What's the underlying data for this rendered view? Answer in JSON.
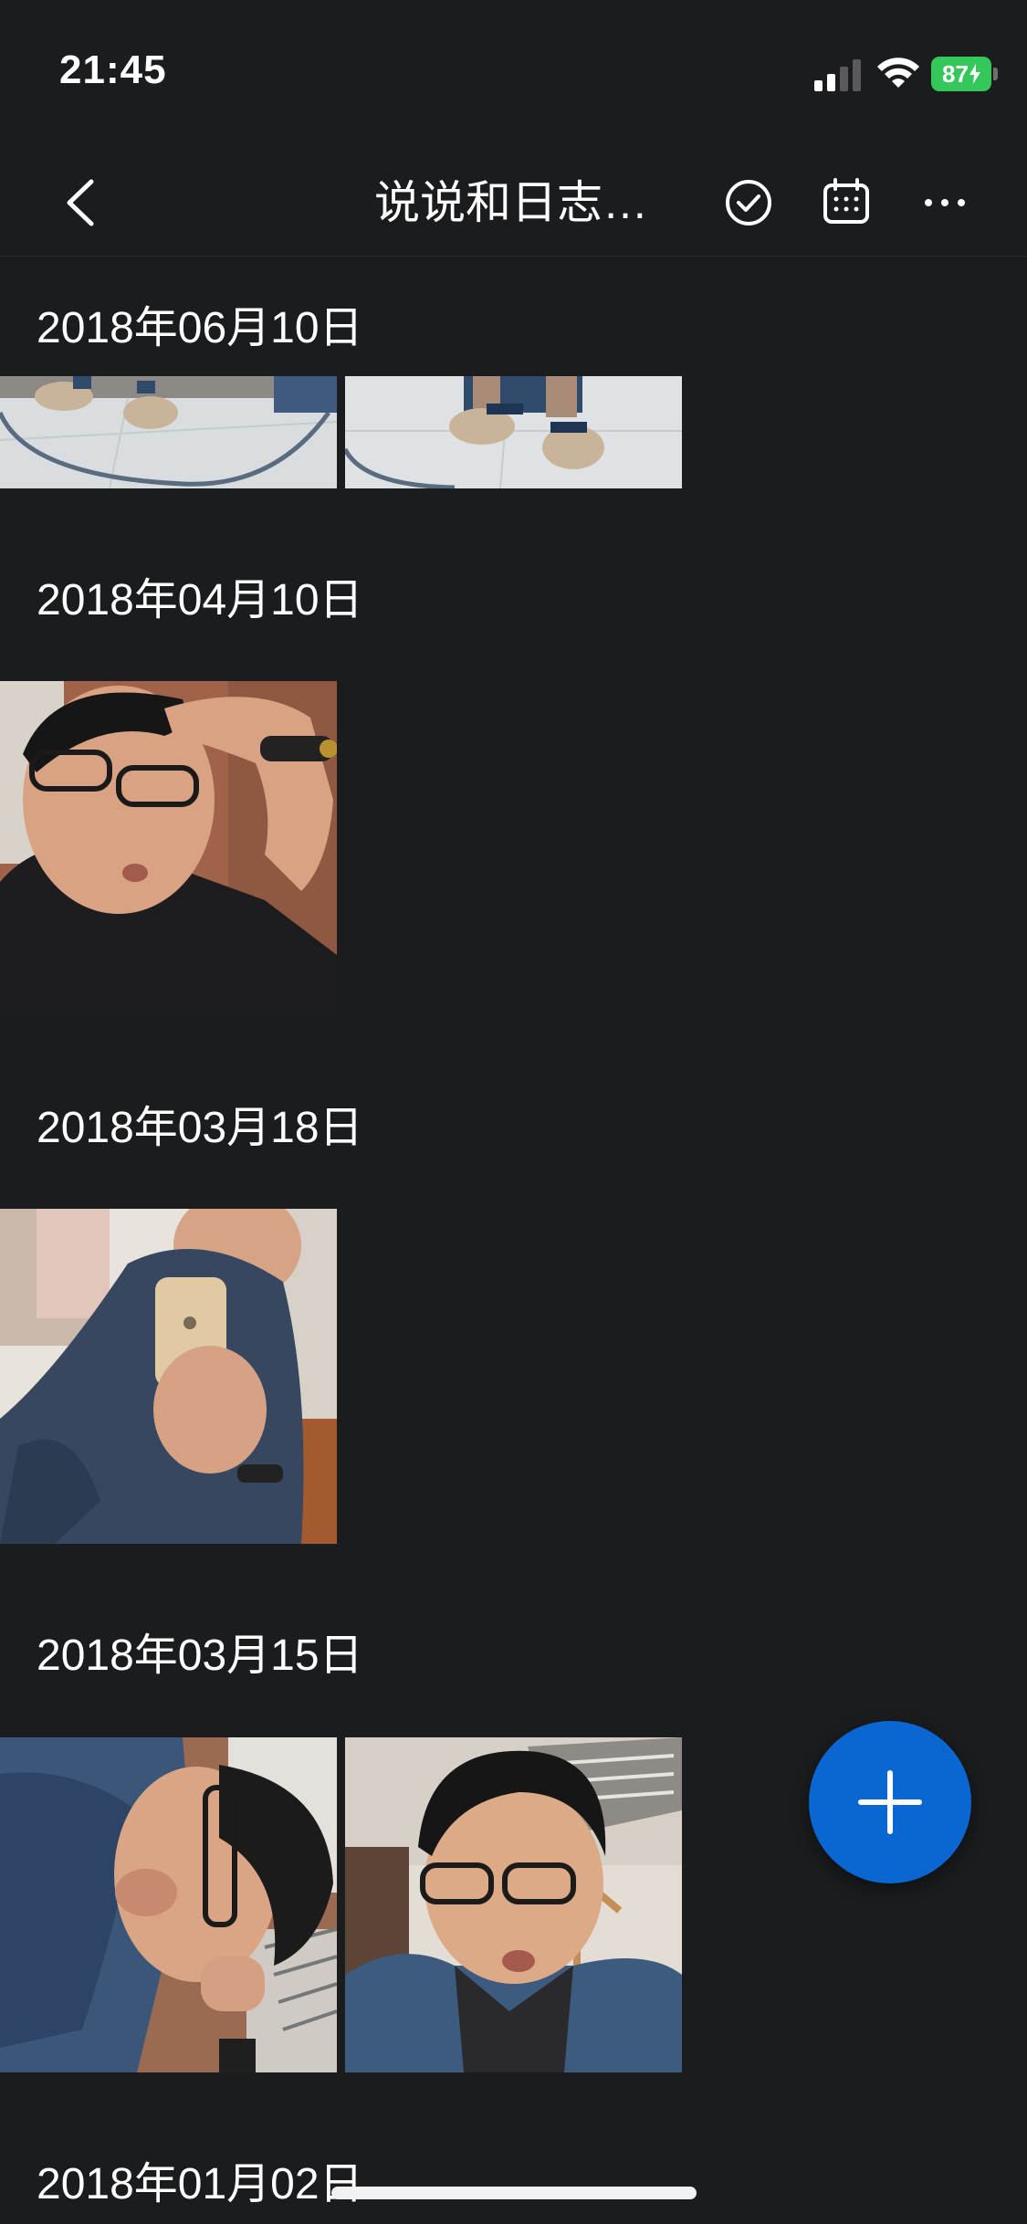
{
  "status_bar": {
    "time": "21:45",
    "battery_level": "87",
    "signal_icon": "cellular-signal-icon",
    "wifi_icon": "wifi-icon"
  },
  "nav": {
    "title": "说说和日志…",
    "back_icon": "chevron-left-icon",
    "select_icon": "checkmark-circle-icon",
    "calendar_icon": "calendar-icon",
    "more_icon": "ellipsis-icon"
  },
  "sections": [
    {
      "date": "2018年06月10日",
      "photo_count_visible": 2
    },
    {
      "date": "2018年04月10日",
      "photo_count_visible": 1
    },
    {
      "date": "2018年03月18日",
      "photo_count_visible": 1
    },
    {
      "date": "2018年03月15日",
      "photo_count_visible": 2
    },
    {
      "date": "2018年01月02日",
      "photo_count_visible": 0
    }
  ],
  "fab": {
    "icon": "plus-icon"
  },
  "colors": {
    "background": "#1b1c1e",
    "accent": "#0a66d1",
    "battery": "#35c759"
  }
}
